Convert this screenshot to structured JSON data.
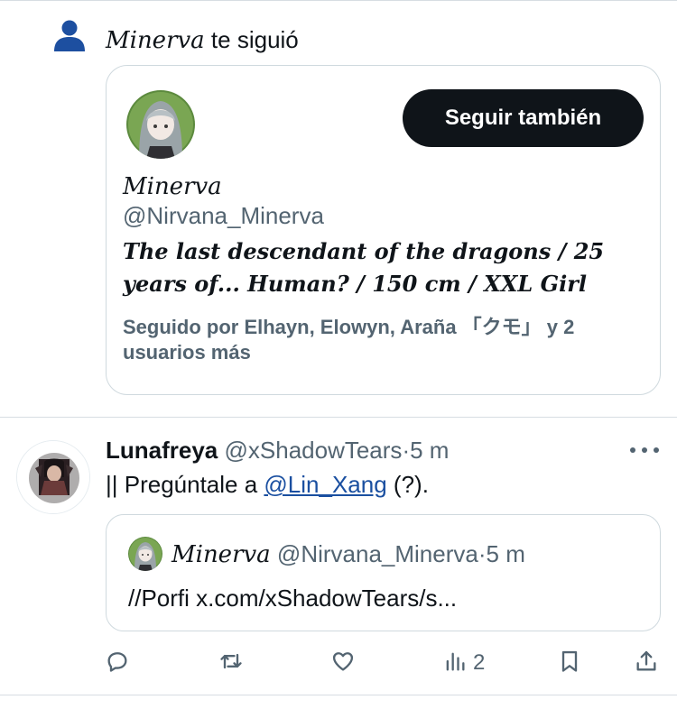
{
  "notification": {
    "follower_name": "Minerva",
    "follow_text": "te siguió",
    "icon": "user-icon"
  },
  "profile_card": {
    "follow_button": "Seguir también",
    "name": "Minerva",
    "handle": "@Nirvana_Minerva",
    "bio": "The last descendant of the dragons / 25 years of... Human? / 150 cm / XXL Girl",
    "followed_by": "Seguido por Elhayn, Elowyn, Araña 「クモ」 y 2 usuarios más"
  },
  "tweet": {
    "author": "Lunafreya",
    "handle": "@xShadowTears",
    "separator": "·",
    "time": "5 m",
    "text_before": "|| Pregúntale a ",
    "mention": "@Lin_Xang",
    "text_after": " (?).",
    "quote": {
      "author": "Minerva",
      "handle": "@Nirvana_Minerva",
      "separator": "·",
      "time": "5 m",
      "text": "//Porfi x.com/xShadowTears/s..."
    },
    "actions": {
      "reply_icon": "reply-icon",
      "retweet_icon": "retweet-icon",
      "like_icon": "heart-icon",
      "views_icon": "views-icon",
      "views_count": "2",
      "bookmark_icon": "bookmark-icon",
      "share_icon": "share-icon"
    }
  },
  "colors": {
    "text_primary": "#0f1419",
    "text_secondary": "#536471",
    "button_bg": "#0f1419",
    "link": "#1a4fa0",
    "border": "#cfd9de"
  }
}
